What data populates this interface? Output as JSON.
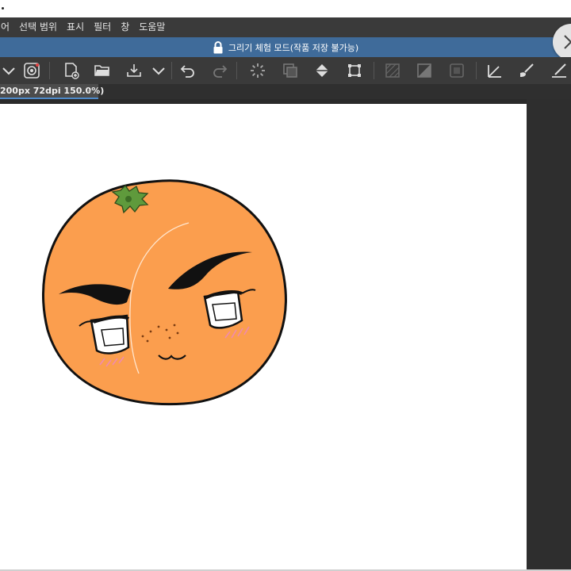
{
  "menu": {
    "items": [
      "어",
      "선택 범위",
      "표시",
      "필터",
      "창",
      "도움말"
    ]
  },
  "trial": {
    "message": "그리기 체험 모드(작품 저장 불가능)"
  },
  "toolbar": {
    "icons": [
      "chevron-down-icon",
      "spiral-icon",
      "new-canvas-icon",
      "open-folder-icon",
      "export-icon",
      "chevron-down-icon",
      "undo-icon",
      "redo-icon",
      "loading-icon",
      "layer-icon",
      "fill-icon",
      "transform-icon",
      "hatch-icon",
      "tone-icon",
      "frame-icon",
      "ruler-icon",
      "brush-icon",
      "pen-icon"
    ]
  },
  "document": {
    "tab_label": "200px 72dpi 150.0%)",
    "tab_close": "•"
  },
  "colors": {
    "menubar": "#3a3a3a",
    "trial_bar": "#3f6b9a",
    "tab_accent": "#4f8ac9",
    "orange_fill": "#fb9e4e",
    "outline": "#111111",
    "leaf": "#5f9a3c",
    "blush": "#f08ab0"
  }
}
